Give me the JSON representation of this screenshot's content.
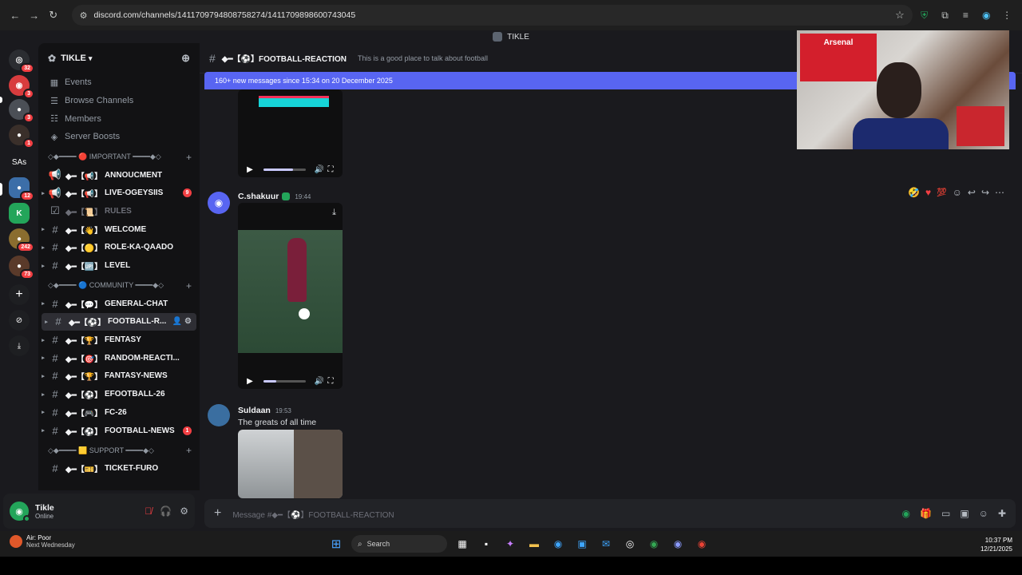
{
  "browser": {
    "url": "discord.com/channels/1411709794808758274/1411709898600743045"
  },
  "app": {
    "window_title": "TIKLE"
  },
  "rail": {
    "servers": [
      {
        "label": "",
        "badge": "32",
        "color": "#2b2d31"
      },
      {
        "label": "",
        "badge": "3",
        "color": "#d83c3e"
      },
      {
        "label": "",
        "badge": "3",
        "color": "#4b4f56"
      },
      {
        "label": "",
        "badge": "1",
        "color": "#3a2f2a"
      },
      {
        "label": "SAs",
        "badge": "",
        "color": "#1a1a1e"
      },
      {
        "label": "",
        "badge": "12",
        "color": "#3c6ea8"
      },
      {
        "label": "K",
        "badge": "",
        "color": "#23a55a"
      },
      {
        "label": "",
        "badge": "242",
        "color": "#8a6d2f"
      },
      {
        "label": "",
        "badge": "73",
        "color": "#5a3a2a"
      }
    ]
  },
  "sidebar": {
    "server_name": "TIKLE",
    "menu": [
      {
        "label": "Events",
        "icon": "calendar-icon"
      },
      {
        "label": "Browse Channels",
        "icon": "list-icon"
      },
      {
        "label": "Members",
        "icon": "members-icon"
      },
      {
        "label": "Server Boosts",
        "icon": "boost-icon"
      }
    ],
    "category_important": "◇◆━━━━ 🔴 IMPORTANT ━━━━◆◇",
    "important_channels": [
      {
        "name": "ANNOUCMENT",
        "prefix": "◆━【📢】",
        "muted": false,
        "badge": ""
      },
      {
        "name": "LIVE-OGEYSIIS",
        "prefix": "◆━【📢】",
        "muted": false,
        "badge": "9"
      },
      {
        "name": "RULES",
        "prefix": "◆━【📜】",
        "muted": true,
        "badge": ""
      },
      {
        "name": "WELCOME",
        "prefix": "◆━【👋】",
        "muted": false,
        "badge": ""
      },
      {
        "name": "ROLE-KA-QAADO",
        "prefix": "◆━【🟡】",
        "muted": false,
        "badge": ""
      },
      {
        "name": "LEVEL",
        "prefix": "◆━【🆙】",
        "muted": false,
        "badge": ""
      }
    ],
    "category_community": "◇◆━━━━ 🔵 COMMUNITY ━━━━◆◇",
    "community_channels": [
      {
        "name": "GENERAL-CHAT",
        "prefix": "◆━【💬】",
        "badge": ""
      },
      {
        "name": "FOOTBALL-R...",
        "prefix": "◆━【⚽】",
        "badge": "",
        "active": true
      },
      {
        "name": "FENTASY",
        "prefix": "◆━【🏆】",
        "badge": ""
      },
      {
        "name": "RANDOM-REACTI...",
        "prefix": "◆━【🎯】",
        "badge": ""
      },
      {
        "name": "FANTASY-NEWS",
        "prefix": "◆━【🏆】",
        "badge": ""
      },
      {
        "name": "EFOOTBALL-26",
        "prefix": "◆━【⚽】",
        "badge": ""
      },
      {
        "name": "FC-26",
        "prefix": "◆━【🎮】",
        "badge": ""
      },
      {
        "name": "FOOTBALL-NEWS",
        "prefix": "◆━【⚽】",
        "badge": "1"
      }
    ],
    "category_support": "◇◆━━━━ 🟨 SUPPORT ━━━━◆◇",
    "support_channels": [
      {
        "name": "TICKET-FURO",
        "prefix": "◆━【🎫】",
        "badge": ""
      }
    ]
  },
  "user": {
    "name": "Tikle",
    "status": "Online"
  },
  "chat": {
    "channel_name": "◆━【⚽】FOOTBALL-REACTION",
    "topic": "This is a good place to talk about football",
    "new_messages_banner": "160+ new messages since 15:34 on 20 December 2025",
    "messages": [
      {
        "author": "C.shakuur",
        "time": "19:44",
        "text": ""
      },
      {
        "author": "Suldaan",
        "time": "19:53",
        "text": "The greats of all time"
      }
    ],
    "video1_progress": 0.7,
    "video2_progress": 0.3,
    "composer_placeholder": "Message #◆━【⚽】FOOTBALL-REACTION"
  },
  "cam": {
    "flag_text": "Arsenal"
  },
  "taskbar": {
    "weather_title": "Air: Poor",
    "weather_sub": "Next Wednesday",
    "search_label": "Search",
    "time": "10:37 PM",
    "date": "12/21/2025"
  }
}
